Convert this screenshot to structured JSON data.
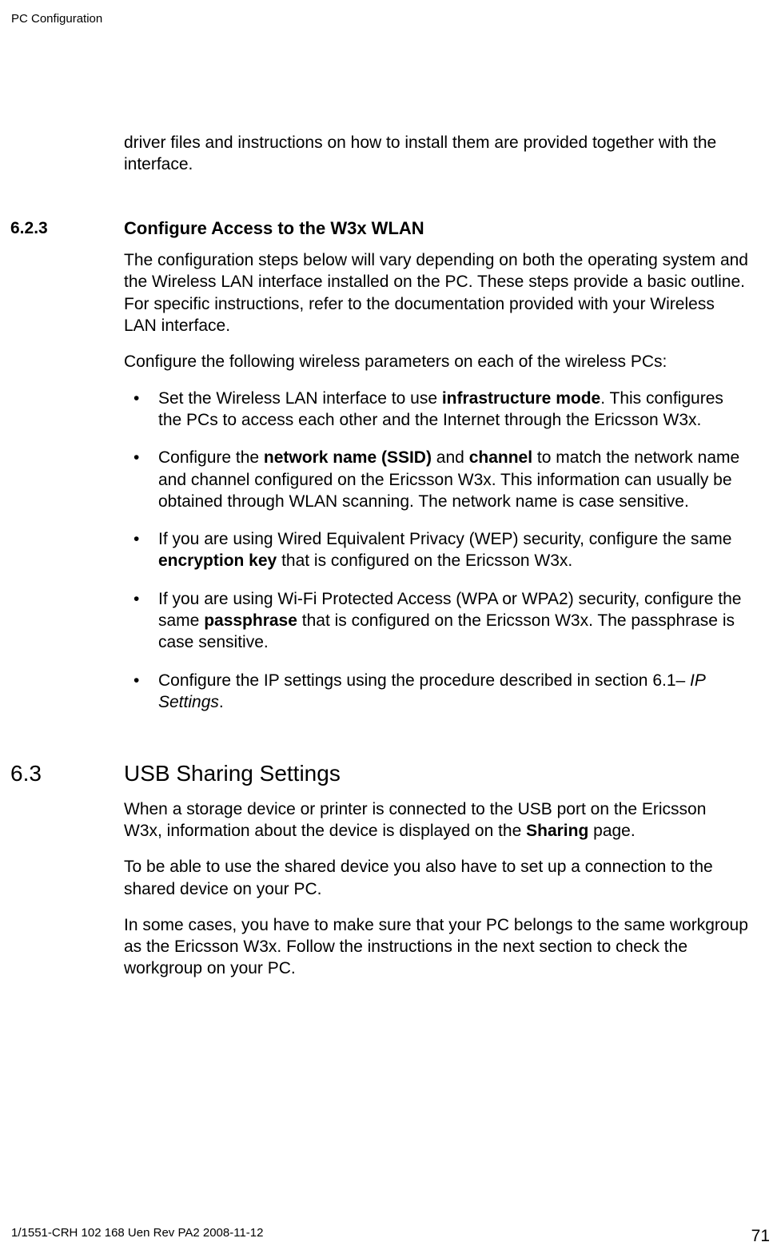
{
  "header": {
    "title": "PC Configuration"
  },
  "intro": {
    "text": "driver files and instructions on how to install them are provided together with the interface."
  },
  "section_623": {
    "number": "6.2.3",
    "title": "Configure Access to the W3x WLAN",
    "p1": "The configuration steps below will vary depending on both the operating system and the Wireless LAN interface installed on the PC. These steps provide a basic outline. For specific instructions, refer to the documentation provided with your Wireless LAN interface.",
    "p2": "Configure the following wireless parameters on each of the wireless PCs:",
    "bullets": {
      "item1_pre": "Set the Wireless LAN interface to use ",
      "item1_b1": "infrastructure mode",
      "item1_post": ". This configures the PCs to access each other and the Internet through the Ericsson W3x.",
      "item2_pre": "Configure the ",
      "item2_b1": "network name (SSID)",
      "item2_mid1": " and ",
      "item2_b2": "channel",
      "item2_post": " to match the network name and channel configured on the Ericsson W3x. This information can usually be obtained through WLAN scanning. The network name is case sensitive.",
      "item3_pre": "If you are using Wired Equivalent Privacy (WEP) security, configure the same ",
      "item3_b1": "encryption key",
      "item3_post": " that is configured on the Ericsson W3x.",
      "item4_pre": "If you are using Wi-Fi Protected Access (WPA or WPA2) security, configure the same ",
      "item4_b1": "passphrase",
      "item4_post": " that is configured on the Ericsson W3x. The passphrase is case sensitive.",
      "item5_pre": "Configure the IP settings using the procedure described in section 6.1– ",
      "item5_i1": "IP Settings",
      "item5_post": "."
    }
  },
  "section_63": {
    "number": "6.3",
    "title": "USB Sharing Settings",
    "p1_pre": "When a storage device or printer is connected to the USB port on the Ericsson W3x, information about the device is displayed on the ",
    "p1_b1": "Sharing",
    "p1_post": " page.",
    "p2": "To be able to use the shared device you also have to set up a connection to the shared device on your PC.",
    "p3": "In some cases, you have to make sure that your PC belongs to the same workgroup as the Ericsson W3x. Follow the instructions in the next section to check the workgroup on your PC."
  },
  "footer": {
    "docref": "1/1551-CRH 102 168 Uen Rev PA2  2008-11-12",
    "pagenum": "71"
  }
}
